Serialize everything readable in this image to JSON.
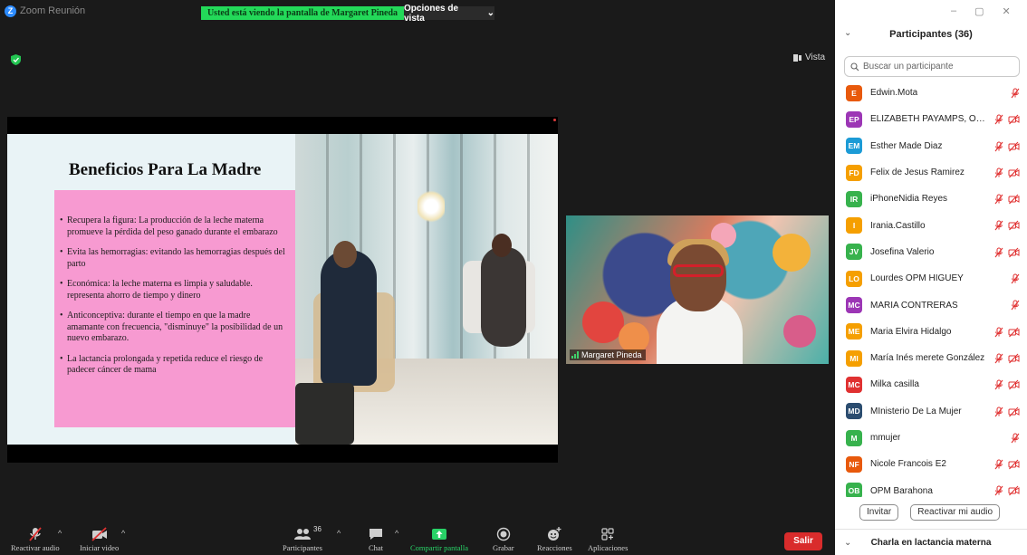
{
  "window": {
    "app_title": "Zoom Reunión",
    "logo_letter": "Z",
    "controls": {
      "minimize": "–",
      "restore": "▢",
      "close": "✕"
    }
  },
  "top_bar": {
    "share_banner": "Usted está viendo la pantalla de Margaret Pineda",
    "view_options": "Opciones de vista",
    "view_options_caret": "⌄",
    "vista_label": "Vista"
  },
  "slide": {
    "title": "Beneficios Para La Madre",
    "bullets": [
      "Recupera la figura: La producción de la leche materna promueve la pérdida del peso ganado durante el embarazo",
      "Evita las hemorragias: evitando las hemorragias después del parto",
      "Económica: la leche materna es limpia y saludable. representa ahorro de tiempo y dinero",
      "Anticonceptiva: durante el tiempo en que la madre amamante con frecuencia, \"disminuye\" la posibilidad de un nuevo embarazo.",
      "La lactancia prolongada y repetida reduce el riesgo de padecer cáncer de mama"
    ]
  },
  "speaker": {
    "name": "Margaret Pineda"
  },
  "toolbar": {
    "unmute": "Reactivar audio",
    "start_video": "Iniciar video",
    "participants": "Participantes",
    "participants_count": "36",
    "chat": "Chat",
    "share_screen": "Compartir pantalla",
    "record": "Grabar",
    "reactions": "Reacciones",
    "apps": "Aplicaciones",
    "leave": "Salir",
    "caret": "^"
  },
  "panel": {
    "collapse_icon": "⌄",
    "title": "Participantes (36)",
    "search_placeholder": "Buscar un participante",
    "participants": [
      {
        "initials": "E",
        "name": "Edwin.Mota",
        "color": "#e8590c",
        "video_off": false
      },
      {
        "initials": "EP",
        "name": "ELIZABETH PAYAMPS, OMM AL...",
        "color": "#9c36b5",
        "video_off": true
      },
      {
        "initials": "EM",
        "name": "Esther Made Diaz",
        "color": "#1c9bd6",
        "video_off": true
      },
      {
        "initials": "FD",
        "name": "Felix de Jesus Ramirez",
        "color": "#f59f00",
        "video_off": true
      },
      {
        "initials": "IR",
        "name": "iPhoneNidia Reyes",
        "color": "#37b24d",
        "video_off": true
      },
      {
        "initials": "I",
        "name": "Irania.Castillo",
        "color": "#f59f00",
        "video_off": true
      },
      {
        "initials": "JV",
        "name": "Josefina Valerio",
        "color": "#37b24d",
        "video_off": true
      },
      {
        "initials": "LO",
        "name": "Lourdes OPM HIGUEY",
        "color": "#f59f00",
        "video_off": false
      },
      {
        "initials": "MC",
        "name": "MARIA CONTRERAS",
        "color": "#9c36b5",
        "video_off": false
      },
      {
        "initials": "ME",
        "name": "Maria Elvira Hidalgo",
        "color": "#f59f00",
        "video_off": true
      },
      {
        "initials": "MI",
        "name": "María Inés merete González",
        "color": "#f59f00",
        "video_off": true
      },
      {
        "initials": "MC",
        "name": "Milka casilla",
        "color": "#e03131",
        "video_off": true
      },
      {
        "initials": "MD",
        "name": "MInisterio De La Mujer",
        "color": "#2b4c6f",
        "video_off": true
      },
      {
        "initials": "M",
        "name": "mmujer",
        "color": "#37b24d",
        "video_off": false
      },
      {
        "initials": "NF",
        "name": "Nicole Francois E2",
        "color": "#e8590c",
        "video_off": true
      },
      {
        "initials": "OB",
        "name": "OPM Barahona",
        "color": "#37b24d",
        "video_off": true
      }
    ],
    "invite": "Invitar",
    "unmute_me": "Reactivar mi audio",
    "chat_title": "Charla en lactancia materna"
  },
  "colors": {
    "accent_green": "#23d959",
    "leave_red": "#d92c2c",
    "slide_pink": "#f79ad1",
    "muted_red": "#e03131"
  }
}
